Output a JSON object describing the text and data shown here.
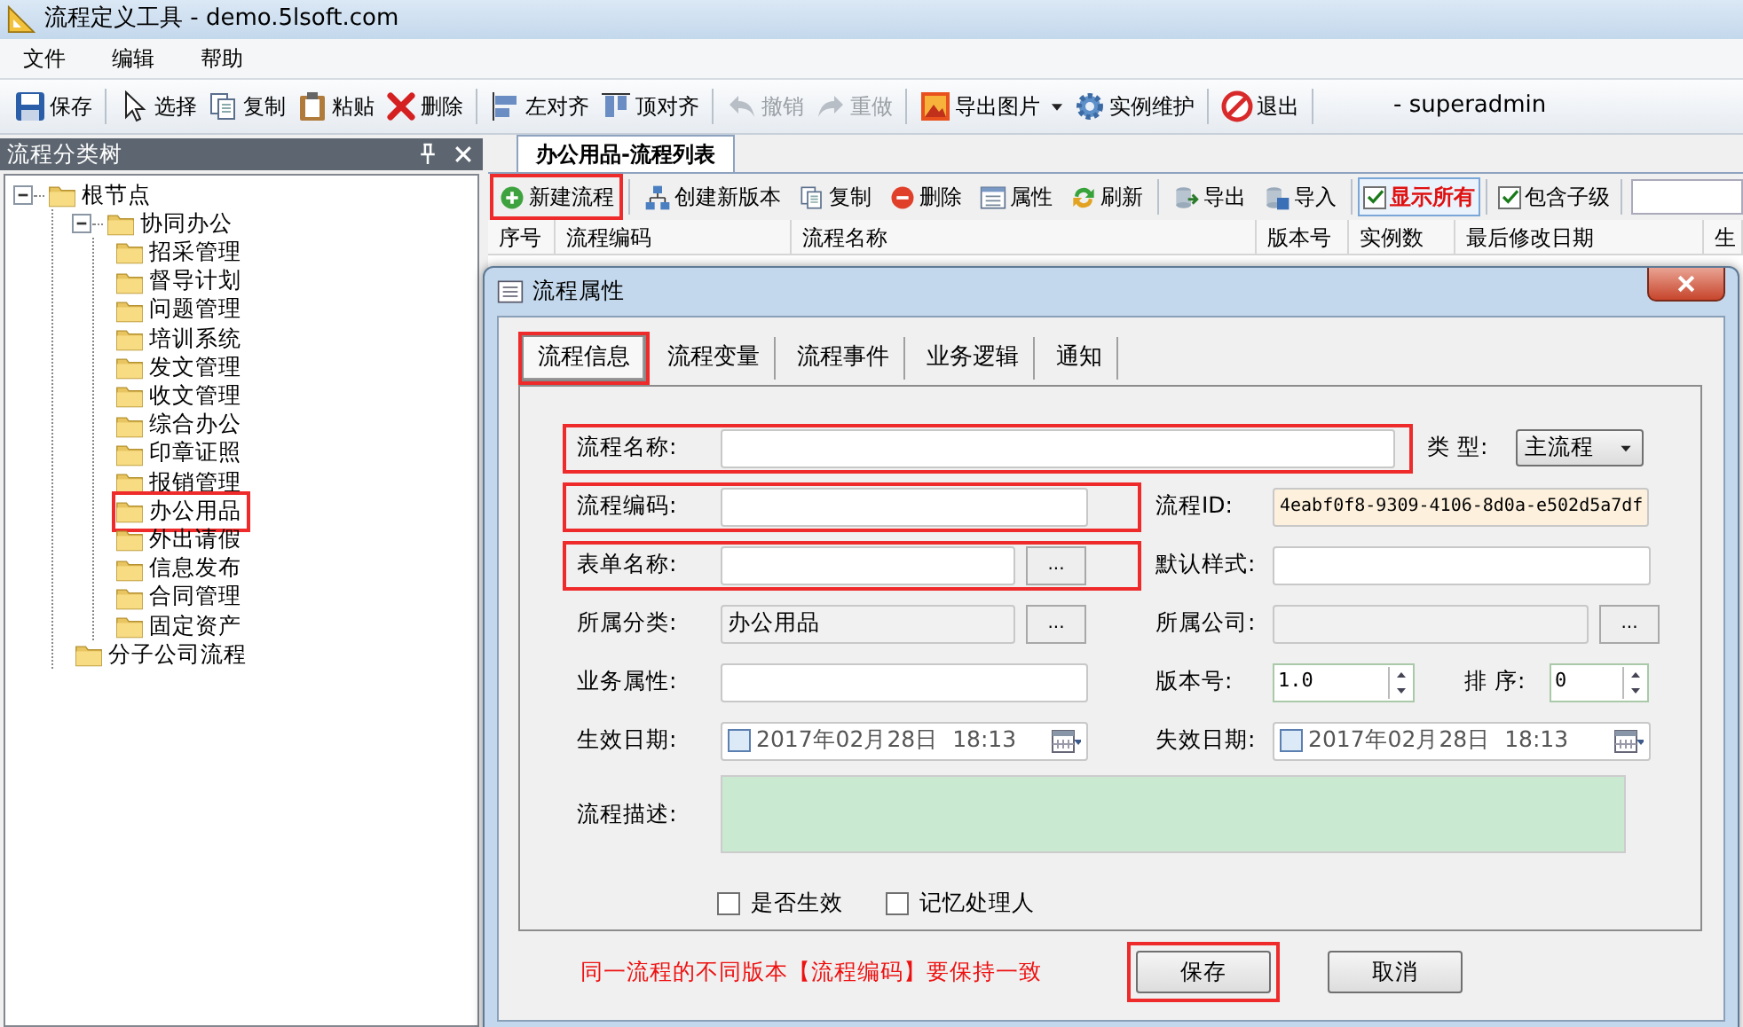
{
  "window": {
    "title": "流程定义工具 - demo.5lsoft.com"
  },
  "menu": [
    {
      "label": "文件"
    },
    {
      "label": "编辑"
    },
    {
      "label": "帮助"
    }
  ],
  "toolbar": [
    [
      {
        "kind": "save",
        "label": "保存",
        "disabled": false,
        "dropdown": false
      }
    ],
    [
      {
        "kind": "cursor",
        "label": "选择",
        "disabled": false,
        "dropdown": false
      },
      {
        "kind": "copy",
        "label": "复制",
        "disabled": false,
        "dropdown": false
      },
      {
        "kind": "paste",
        "label": "粘贴",
        "disabled": false,
        "dropdown": false
      },
      {
        "kind": "delete",
        "label": "删除",
        "disabled": false,
        "dropdown": false
      }
    ],
    [
      {
        "kind": "align-left",
        "label": "左对齐",
        "disabled": false,
        "dropdown": false
      },
      {
        "kind": "align-top",
        "label": "顶对齐",
        "disabled": false,
        "dropdown": false
      }
    ],
    [
      {
        "kind": "undo",
        "label": "撤销",
        "disabled": true,
        "dropdown": false
      },
      {
        "kind": "redo",
        "label": "重做",
        "disabled": true,
        "dropdown": false
      }
    ],
    [
      {
        "kind": "image",
        "label": "导出图片",
        "disabled": false,
        "dropdown": true
      },
      {
        "kind": "gear",
        "label": "实例维护",
        "disabled": false,
        "dropdown": false
      }
    ],
    [
      {
        "kind": "exit",
        "label": "退出",
        "disabled": false,
        "dropdown": false
      }
    ]
  ],
  "user": "- superadmin",
  "sidebar": {
    "title": "流程分类树",
    "tree": [
      {
        "label": "根节点",
        "expanded": true,
        "highlighted": false,
        "children": [
          {
            "label": "协同办公",
            "expanded": true,
            "highlighted": false,
            "children": [
              {
                "label": "招采管理",
                "highlighted": false
              },
              {
                "label": "督导计划",
                "highlighted": false
              },
              {
                "label": "问题管理",
                "highlighted": false
              },
              {
                "label": "培训系统",
                "highlighted": false
              },
              {
                "label": "发文管理",
                "highlighted": false
              },
              {
                "label": "收文管理",
                "highlighted": false
              },
              {
                "label": "综合办公",
                "highlighted": false
              },
              {
                "label": "印章证照",
                "highlighted": false
              },
              {
                "label": "报销管理",
                "highlighted": false
              },
              {
                "label": "办公用品",
                "highlighted": true
              },
              {
                "label": "外出请假",
                "highlighted": false
              },
              {
                "label": "信息发布",
                "highlighted": false
              },
              {
                "label": "合同管理",
                "highlighted": false
              },
              {
                "label": "固定资产",
                "highlighted": false
              }
            ]
          },
          {
            "label": "分子公司流程",
            "highlighted": false
          }
        ]
      }
    ]
  },
  "tabs": [
    {
      "label": "办公用品-流程列表",
      "selected": true
    }
  ],
  "list_toolbar": [
    [
      {
        "kind": "add",
        "label": "新建流程",
        "highlighted": true
      }
    ],
    [
      {
        "kind": "version",
        "label": "创建新版本",
        "highlighted": false
      },
      {
        "kind": "copy",
        "label": "复制",
        "highlighted": false
      },
      {
        "kind": "remove",
        "label": "删除",
        "highlighted": false
      },
      {
        "kind": "properties",
        "label": "属性",
        "highlighted": false
      },
      {
        "kind": "refresh",
        "label": "刷新",
        "highlighted": false
      }
    ],
    [
      {
        "kind": "export",
        "label": "导出",
        "highlighted": false
      },
      {
        "kind": "import",
        "label": "导入",
        "highlighted": false
      }
    ],
    [
      {
        "kind": "checkbox",
        "label": "显示所有",
        "checked": true,
        "pressed": true
      }
    ],
    [
      {
        "kind": "checkbox",
        "label": "包含子级",
        "checked": true,
        "pressed": false
      }
    ]
  ],
  "table": {
    "columns": [
      "序号",
      "流程编码",
      "流程名称",
      "版本号",
      "实例数",
      "最后修改日期",
      "生"
    ]
  },
  "dialog": {
    "title": "流程属性",
    "tabs": [
      {
        "label": "流程信息",
        "selected": true,
        "highlighted": true
      },
      {
        "label": "流程变量",
        "selected": false,
        "highlighted": false
      },
      {
        "label": "流程事件",
        "selected": false,
        "highlighted": false
      },
      {
        "label": "业务逻辑",
        "selected": false,
        "highlighted": false
      },
      {
        "label": "通知",
        "selected": false,
        "highlighted": false
      }
    ],
    "rows": [
      [
        {
          "kind": "text",
          "label": "流程名称:",
          "highlighted": true
        },
        {
          "kind": "select",
          "label": "类 型:",
          "value": "主流程",
          "highlighted": false
        }
      ],
      [
        {
          "kind": "text",
          "label": "流程编码:",
          "highlighted": true
        },
        {
          "kind": "readonly-id",
          "label": "流程ID:",
          "value": "4eabf0f8-9309-4106-8d0a-e502d5a7df",
          "highlighted": false
        }
      ],
      [
        {
          "kind": "picker",
          "label": "表单名称:",
          "button": "...",
          "disabled": false,
          "highlighted": true
        },
        {
          "kind": "text",
          "label": "默认样式:",
          "highlighted": false
        }
      ],
      [
        {
          "kind": "picker",
          "label": "所属分类:",
          "value": "办公用品",
          "button": "...",
          "disabled": true,
          "highlighted": false
        },
        {
          "kind": "picker",
          "label": "所属公司:",
          "button": "...",
          "disabled": true,
          "highlighted": false
        }
      ],
      [
        {
          "kind": "text",
          "label": "业务属性:",
          "highlighted": false
        },
        {
          "kind": "spinner",
          "label": "版本号:",
          "value": "1.0",
          "highlighted": false
        },
        {
          "kind": "spinner",
          "label": "排 序:",
          "value": "0",
          "highlighted": false
        }
      ],
      [
        {
          "kind": "date",
          "label": "生效日期:",
          "value": "2017年02月28日  18:13",
          "checked": false,
          "highlighted": false
        },
        {
          "kind": "date",
          "label": "失效日期:",
          "value": "2017年02月28日  18:13",
          "checked": false,
          "highlighted": false
        }
      ],
      [
        {
          "kind": "textarea",
          "label": "流程描述:",
          "highlighted": false
        }
      ]
    ],
    "checkboxes": [
      {
        "label": "是否生效",
        "checked": false
      },
      {
        "label": "记忆处理人",
        "checked": false
      }
    ],
    "note": "同一流程的不同版本【流程编码】要保持一致",
    "buttons": [
      {
        "label": "保存",
        "highlighted": true
      },
      {
        "label": "取消",
        "highlighted": false
      }
    ]
  }
}
